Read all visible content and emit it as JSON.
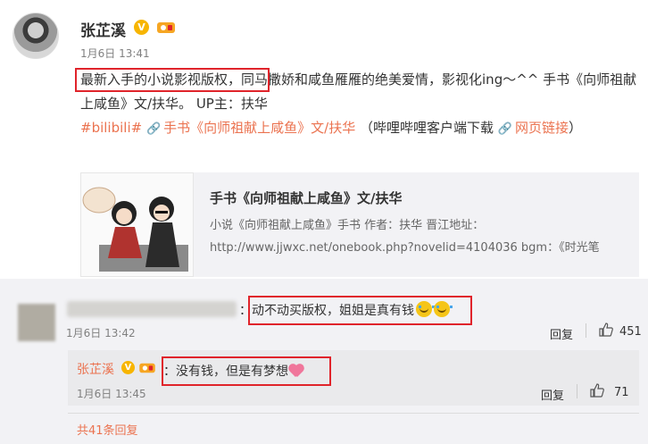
{
  "post": {
    "author": "张芷溪",
    "verified_mark": "V",
    "time": "1月6日 13:41",
    "text_highlight": "最新入手的小说影视版权，",
    "text_rest": "同马撒娇和咸鱼雁雁的绝美爱情，影视化ing～^^ 手书《向师祖献上咸鱼》文/扶华。 UP主：扶华",
    "tag": "#bilibili#",
    "link1": "手书《向师祖献上咸鱼》文/扶华",
    "link_note": "（哔哩哔哩客户端下载",
    "link2": "网页链接",
    "link_close": "）"
  },
  "card": {
    "title": "手书《向师祖献上咸鱼》文/扶华",
    "desc1": "小说《向师祖献上咸鱼》手书 作者：扶华 晋江地址：",
    "desc2": "http://www.jjwxc.net/onebook.php?novelid=4104036 bgm：《时光笔"
  },
  "comment1": {
    "prefix": "：",
    "text": "动不动买版权，姐姐是真有钱",
    "time": "1月6日 13:42",
    "reply_label": "回复",
    "likes": "451"
  },
  "reply": {
    "author": "张芷溪",
    "verified_mark": "V",
    "prefix": "：",
    "text": "没有钱，但是有梦想",
    "time": "1月6日 13:45",
    "reply_label": "回复",
    "likes": "71"
  },
  "more_replies": "共41条回复",
  "colors": {
    "accent": "#eb7350",
    "highlight_box": "#e0242b",
    "verified": "#f7b500"
  }
}
